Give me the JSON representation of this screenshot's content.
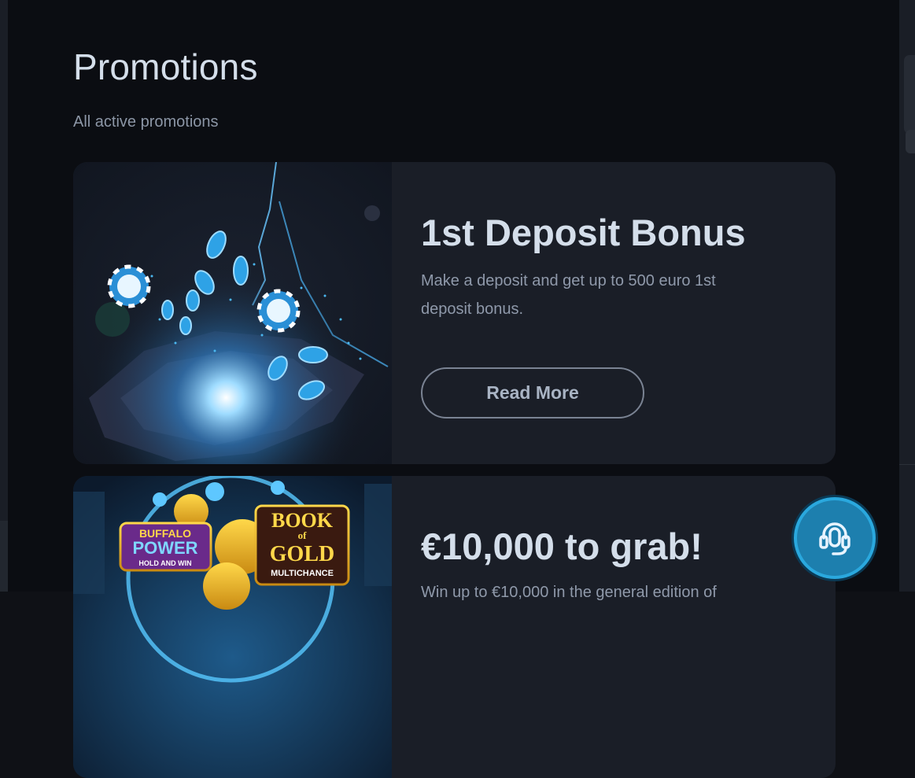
{
  "page": {
    "title": "Promotions",
    "subtitle": "All active promotions"
  },
  "promotions": [
    {
      "title": "1st Deposit Bonus",
      "description": "Make a deposit and get up to 500 euro 1st deposit bonus.",
      "button_label": "Read More",
      "image": "casino-chips-lightning-image"
    },
    {
      "title": "€10,000 to grab!",
      "description": "Win up to €10,000 in the general edition of",
      "image": "buffalo-power-book-of-gold-image",
      "image_texts": [
        "BUFFALO",
        "POWER",
        "HOLD AND WIN",
        "BOOK",
        "of",
        "GOLD",
        "MULTICHANCE"
      ]
    }
  ],
  "support": {
    "icon": "headset-icon"
  },
  "colors": {
    "background": "#0b0d12",
    "card": "#1a1e27",
    "title_text": "#d4deea",
    "muted_text": "#8f99aa",
    "support_accent": "#2aa8de"
  }
}
